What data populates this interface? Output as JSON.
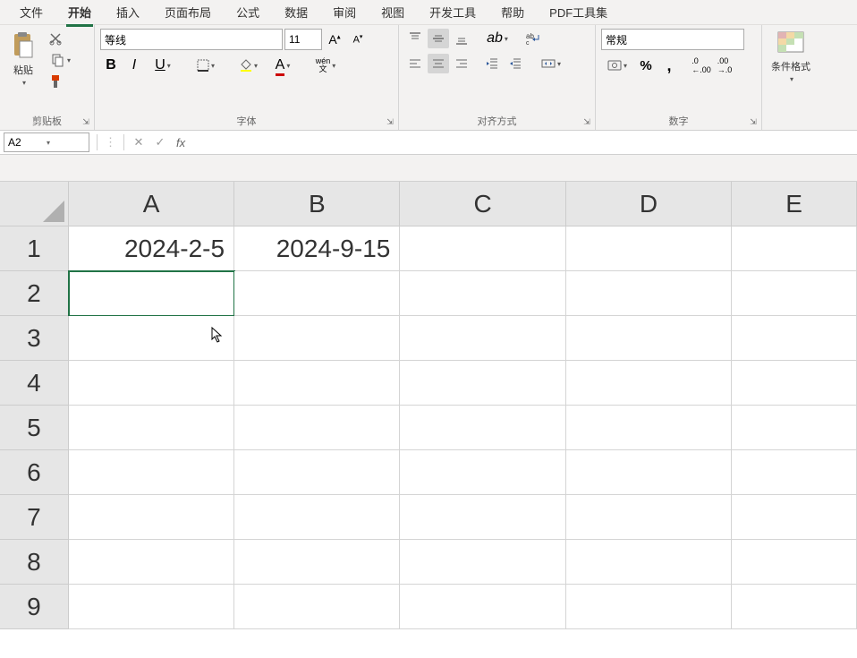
{
  "menu": {
    "items": [
      "文件",
      "开始",
      "插入",
      "页面布局",
      "公式",
      "数据",
      "审阅",
      "视图",
      "开发工具",
      "帮助",
      "PDF工具集"
    ],
    "active_index": 1
  },
  "ribbon": {
    "clipboard": {
      "label": "剪贴板",
      "paste": "粘贴"
    },
    "font": {
      "label": "字体",
      "name": "等线",
      "size": "11",
      "pinyin": "wén"
    },
    "alignment": {
      "label": "对齐方式"
    },
    "number": {
      "label": "数字",
      "format": "常规"
    },
    "styles": {
      "cond_format": "条件格式"
    }
  },
  "namebox": {
    "value": "A2"
  },
  "formula": {
    "value": ""
  },
  "grid": {
    "columns": [
      "A",
      "B",
      "C",
      "D",
      "E"
    ],
    "rows": [
      "1",
      "2",
      "3",
      "4",
      "5",
      "6",
      "7",
      "8",
      "9"
    ],
    "cells": {
      "A1": "2024-2-5",
      "B1": "2024-9-15"
    },
    "selected": "A2"
  }
}
